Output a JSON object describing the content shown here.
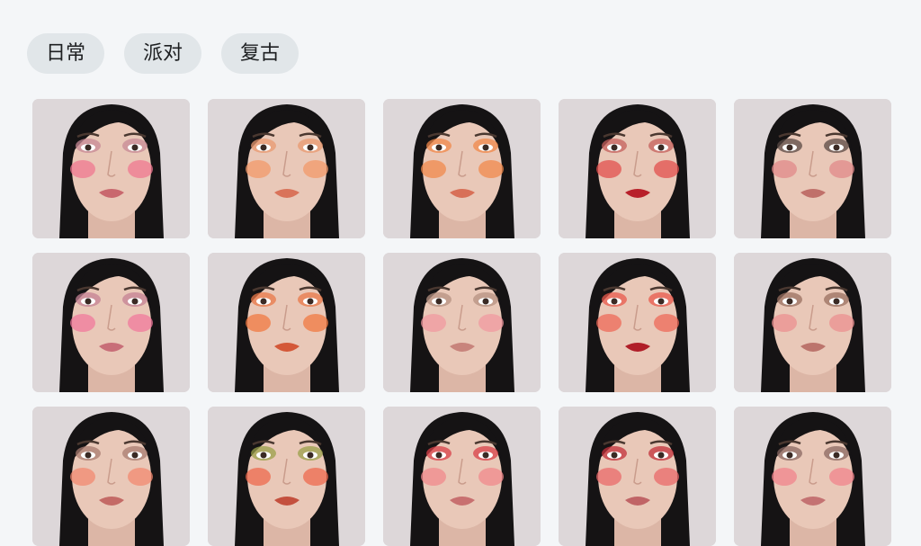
{
  "tabs": [
    {
      "label": "日常",
      "name": "tab-daily"
    },
    {
      "label": "派对",
      "name": "tab-party"
    },
    {
      "label": "复古",
      "name": "tab-retro"
    }
  ],
  "palette": {
    "background": "#f4f6f8",
    "tab_bg": "#e1e6e9",
    "hair": "#151314",
    "skin": "#e9c8b8",
    "eye": "#3a2a24"
  },
  "looks": [
    {
      "name": "pink-daily",
      "eyeshadow": "#c78a96",
      "blush": "#ef7890",
      "lips": "#c9686e"
    },
    {
      "name": "peach-orange",
      "eyeshadow": "#e89a70",
      "blush": "#f29a6a",
      "lips": "#d9735a"
    },
    {
      "name": "bright-orange",
      "eyeshadow": "#f0884a",
      "blush": "#f08a4c",
      "lips": "#d87058"
    },
    {
      "name": "red-glam",
      "eyeshadow": "#c4605c",
      "blush": "#e2504e",
      "lips": "#b8202a"
    },
    {
      "name": "smoky-neutral",
      "eyeshadow": "#5a4a44",
      "blush": "#e08a8a",
      "lips": "#c0706a"
    },
    {
      "name": "rosy-pink",
      "eyeshadow": "#c48294",
      "blush": "#f07a9c",
      "lips": "#c86e78"
    },
    {
      "name": "sunset-orange",
      "eyeshadow": "#e87848",
      "blush": "#f07a42",
      "lips": "#d45838"
    },
    {
      "name": "soft-nude",
      "eyeshadow": "#b59282",
      "blush": "#f09aa0",
      "lips": "#c8847c"
    },
    {
      "name": "coral-sparkle",
      "eyeshadow": "#e85a4c",
      "blush": "#ee6a58",
      "lips": "#b01e28"
    },
    {
      "name": "warm-brown",
      "eyeshadow": "#9a7060",
      "blush": "#eb9090",
      "lips": "#bc746c"
    },
    {
      "name": "coral-daily",
      "eyeshadow": "#a87c70",
      "blush": "#f28a70",
      "lips": "#c46a66"
    },
    {
      "name": "olive-green",
      "eyeshadow": "#9aa04a",
      "blush": "#ee6a4e",
      "lips": "#c4503e"
    },
    {
      "name": "red-retro",
      "eyeshadow": "#d84048",
      "blush": "#f08a8c",
      "lips": "#c87070"
    },
    {
      "name": "crimson-smoky",
      "eyeshadow": "#c2303a",
      "blush": "#ea6a6a",
      "lips": "#c06466"
    },
    {
      "name": "soft-pink-retro",
      "eyeshadow": "#8a6862",
      "blush": "#f0848c",
      "lips": "#c47272"
    }
  ]
}
